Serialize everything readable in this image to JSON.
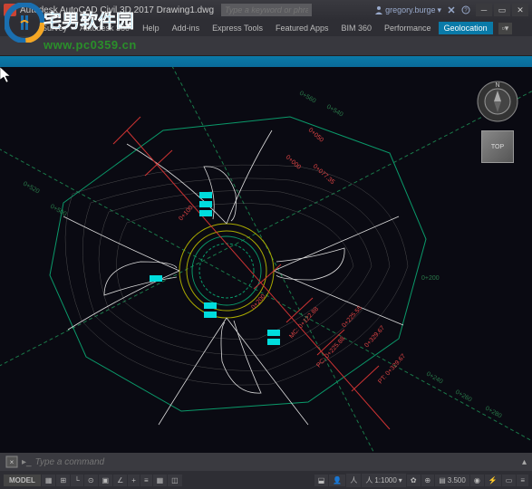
{
  "title": "Autodesk AutoCAD Civil 3D 2017   Drawing1.dwg",
  "search": {
    "placeholder": "Type a keyword or phrase"
  },
  "user": {
    "name": "gregory.burge"
  },
  "ribbon": {
    "tabs": [
      "Survey",
      "Autodesk 360",
      "Help",
      "Add-ins",
      "Express Tools",
      "Featured Apps",
      "BIM 360",
      "Performance",
      "Geolocation"
    ],
    "active": "Geolocation"
  },
  "watermark": {
    "url": "www.pc0359.cn",
    "logo_cn": "宅男软件园"
  },
  "navcube": {
    "face": "TOP"
  },
  "command": {
    "placeholder": "Type a command"
  },
  "status": {
    "mode": "MODEL",
    "scale": "1:1000",
    "decimal": "3.500",
    "icons": [
      "grid",
      "snap",
      "ortho",
      "polar",
      "osnap",
      "3dosnap",
      "otrack",
      "dyn",
      "lwt",
      "trans",
      "cycle",
      "qp",
      "ann",
      "auto"
    ]
  },
  "drawing": {
    "stations_red": [
      "0+000",
      "0+050",
      "0+077.35",
      "0+100",
      "0+150",
      "0+200",
      "0+122.88",
      "0+225.55",
      "0+329.67",
      "PC: 0+225.88",
      "PT: 0+329.67",
      "MC: 0+122.88"
    ],
    "stations_green": [
      "0+560",
      "0+540",
      "0+520",
      "0+500",
      "0+240",
      "0+260",
      "0+280",
      "0+200"
    ]
  }
}
